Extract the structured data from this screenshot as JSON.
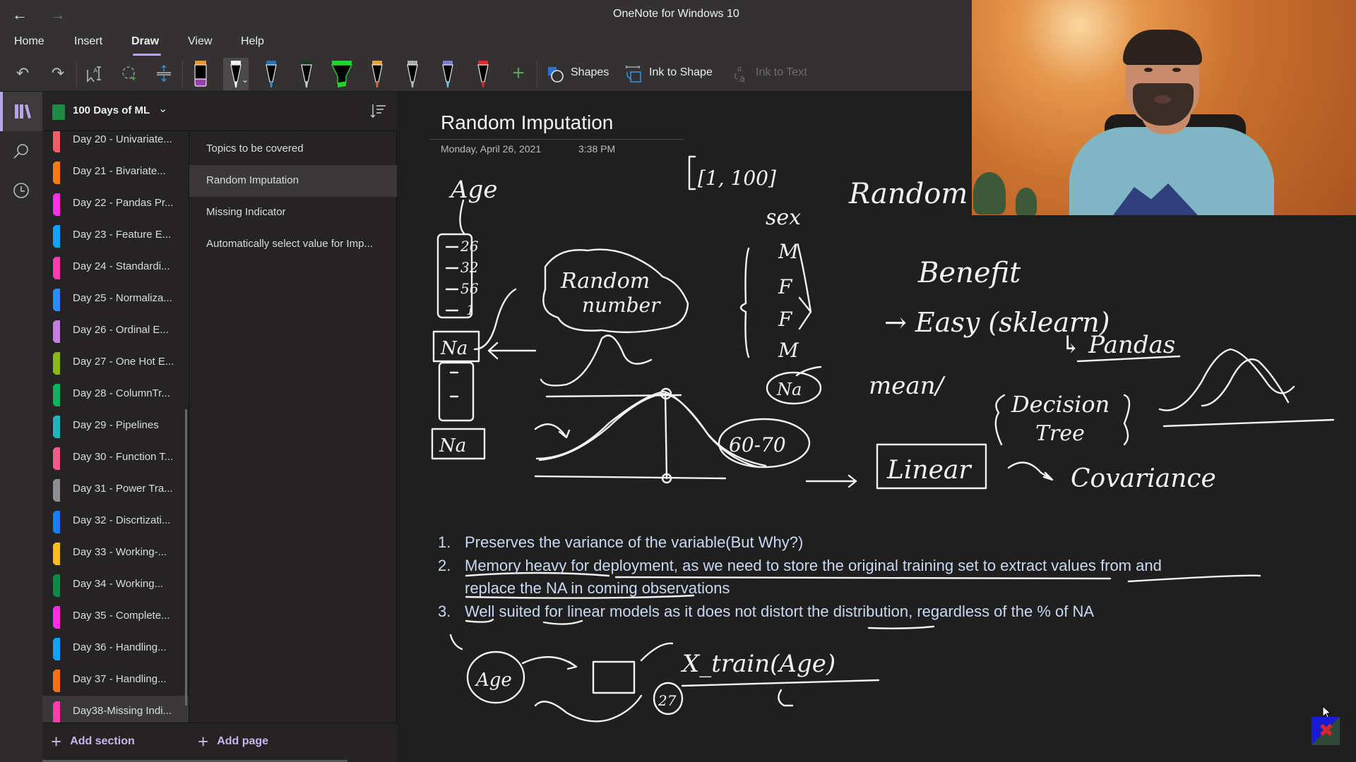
{
  "window": {
    "title": "OneNote for Windows 10",
    "back_icon": "←",
    "forward_icon": "→"
  },
  "menu": {
    "items": [
      "Home",
      "Insert",
      "Draw",
      "View",
      "Help"
    ],
    "active": "Draw"
  },
  "toolbar": {
    "undo_icon": "↶",
    "redo_icon": "↷",
    "pens": [
      {
        "name": "eraser",
        "tip": "#9b3fb0",
        "top": "#f0962e",
        "selected": false
      },
      {
        "name": "white-pen",
        "tip": "#ffffff",
        "top": "#f0f0f0",
        "selected": true
      },
      {
        "name": "blue-pen",
        "tip": "#2f8fd4",
        "top": "#1f73b0",
        "selected": false
      },
      {
        "name": "dark-green-pen",
        "tip": "#cfcfcf",
        "top": "#173a26",
        "selected": false
      },
      {
        "name": "green-highlighter",
        "tip": "#22d32b",
        "top": "#22d32b",
        "selected": false
      },
      {
        "name": "galaxy-pen",
        "tip": "#e0623a",
        "top": "#e8a23a",
        "selected": false
      },
      {
        "name": "silver-pencil",
        "tip": "#bdbdbd",
        "top": "#a9a9a9",
        "selected": false
      },
      {
        "name": "ocean-pen",
        "tip": "#6cc3e0",
        "top": "#7a7dd0",
        "selected": false
      },
      {
        "name": "red-pen",
        "tip": "#e02a2a",
        "top": "#e02a2a",
        "selected": false
      }
    ],
    "add_pen_icon": "+",
    "shapes_label": "Shapes",
    "ink_to_shape_label": "Ink to Shape",
    "ink_to_text_label": "Ink to Text"
  },
  "notebook": {
    "name": "100 Days of ML",
    "color": "#1e8a46"
  },
  "sections": [
    {
      "label": "Day 20 - Univariate...",
      "color": "#f25e64"
    },
    {
      "label": "Day 21 - Bivariate...",
      "color": "#ff7a10"
    },
    {
      "label": "Day 22 - Pandas Pr...",
      "color": "#ff2ee8"
    },
    {
      "label": "Day 23 - Feature E...",
      "color": "#14a1ff"
    },
    {
      "label": "Day 24 - Standardi...",
      "color": "#ff3bad"
    },
    {
      "label": "Day 25 - Normaliza...",
      "color": "#2b8cff"
    },
    {
      "label": "Day 26 - Ordinal E...",
      "color": "#c57de0"
    },
    {
      "label": "Day 27 - One Hot E...",
      "color": "#8ab814"
    },
    {
      "label": "Day 28 - ColumnTr...",
      "color": "#0fb25a"
    },
    {
      "label": "Day 29 - Pipelines",
      "color": "#1db5c0"
    },
    {
      "label": "Day 30 - Function T...",
      "color": "#f05d8a"
    },
    {
      "label": "Day 31 - Power Tra...",
      "color": "#8c9094"
    },
    {
      "label": "Day 32 - Discrtizati...",
      "color": "#1a7cff"
    },
    {
      "label": "Day 33 - Working-...",
      "color": "#ffbe14"
    },
    {
      "label": "Day 34 - Working...",
      "color": "#0a8a47"
    },
    {
      "label": "Day 35 - Complete...",
      "color": "#ff2ee0"
    },
    {
      "label": "Day 36 - Handling...",
      "color": "#14a1ff"
    },
    {
      "label": "Day 37 - Handling...",
      "color": "#ff7010"
    },
    {
      "label": "Day38-Missing Indi...",
      "color": "#ff3bad",
      "selected": true
    }
  ],
  "pages": [
    {
      "label": "Topics to be covered"
    },
    {
      "label": "Random Imputation",
      "selected": true
    },
    {
      "label": "Missing Indicator"
    },
    {
      "label": "Automatically select value for Imp..."
    }
  ],
  "footer": {
    "add_section": "Add section",
    "add_page": "Add page"
  },
  "page": {
    "title": "Random Imputation",
    "date": "Monday, April 26, 2021",
    "time": "3:38 PM",
    "notes": [
      {
        "num": "1.",
        "text": "Preserves the variance of the variable(But Why?)"
      },
      {
        "num": "2.",
        "text": "Memory heavy for deployment, as we need to store the original training set to extract values from and"
      },
      {
        "num": "",
        "text": "replace the NA in coming observations"
      },
      {
        "num": "3.",
        "text": "Well suited for linear models as it does not distort the distribution, regardless of the % of NA"
      }
    ],
    "handwriting": {
      "age": "Age",
      "range": "[1, 100]",
      "random": "Random",
      "sex": "sex",
      "random_number_line1": "Random",
      "random_number_line2": "number",
      "values": [
        "26",
        "32",
        "56",
        "1"
      ],
      "na1": "Na",
      "na2": "Na",
      "sex_values": [
        "M",
        "F",
        "F",
        "M"
      ],
      "na3": "Na",
      "range2": "60-70",
      "benefit": "Benefit",
      "easy": "→ Easy (sklearn)",
      "pandas": "↳ Pandas",
      "mean": "mean/",
      "decision_tree_1": "Decision",
      "decision_tree_2": "Tree",
      "linear": "Linear",
      "covariance": "Covariance",
      "age_circle": "Age",
      "x_train": "X_train(Age)",
      "num27": "27"
    }
  },
  "presenter": {
    "description": "webcam overlay of presenter"
  },
  "colors": {
    "accent": "#b4a7e6",
    "background": "#201f1f",
    "chrome": "#333131",
    "note_text": "#c9d9f2"
  }
}
